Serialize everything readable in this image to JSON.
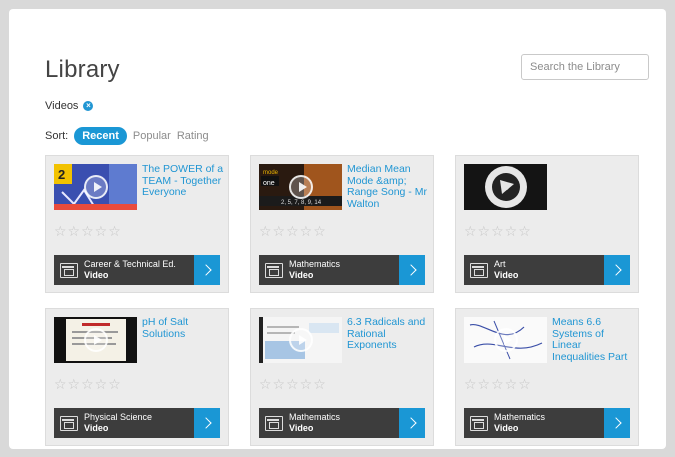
{
  "library": {
    "title": "Library",
    "search_placeholder": "Search the Library",
    "filter_label": "Videos",
    "sort_label": "Sort:",
    "sort_options": [
      "Recent",
      "Popular",
      "Rating"
    ],
    "star_rating": "☆☆☆☆☆"
  },
  "cards": [
    {
      "title": "The POWER of a TEAM - Together Everyone",
      "category": "Career & Technical Ed.",
      "type": "Video",
      "rating_stars": 0
    },
    {
      "title": "Median Mean Mode &amp; Range Song - Mr Walton",
      "category": "Mathematics",
      "type": "Video",
      "rating_stars": 0
    },
    {
      "title": "",
      "category": "Art",
      "type": "Video",
      "rating_stars": 0
    },
    {
      "title": "pH of Salt Solutions",
      "category": "Physical Science",
      "type": "Video",
      "rating_stars": 0
    },
    {
      "title": "6.3 Radicals and Rational Exponents",
      "category": "Mathematics",
      "type": "Video",
      "rating_stars": 0
    },
    {
      "title": "Means 6.6 Systems of Linear Inequalities Part",
      "category": "Mathematics",
      "type": "Video",
      "rating_stars": 0
    }
  ],
  "colors": {
    "accent": "#1a97d5",
    "card_bar": "#3d3d3d",
    "title_link": "#2196d3"
  }
}
